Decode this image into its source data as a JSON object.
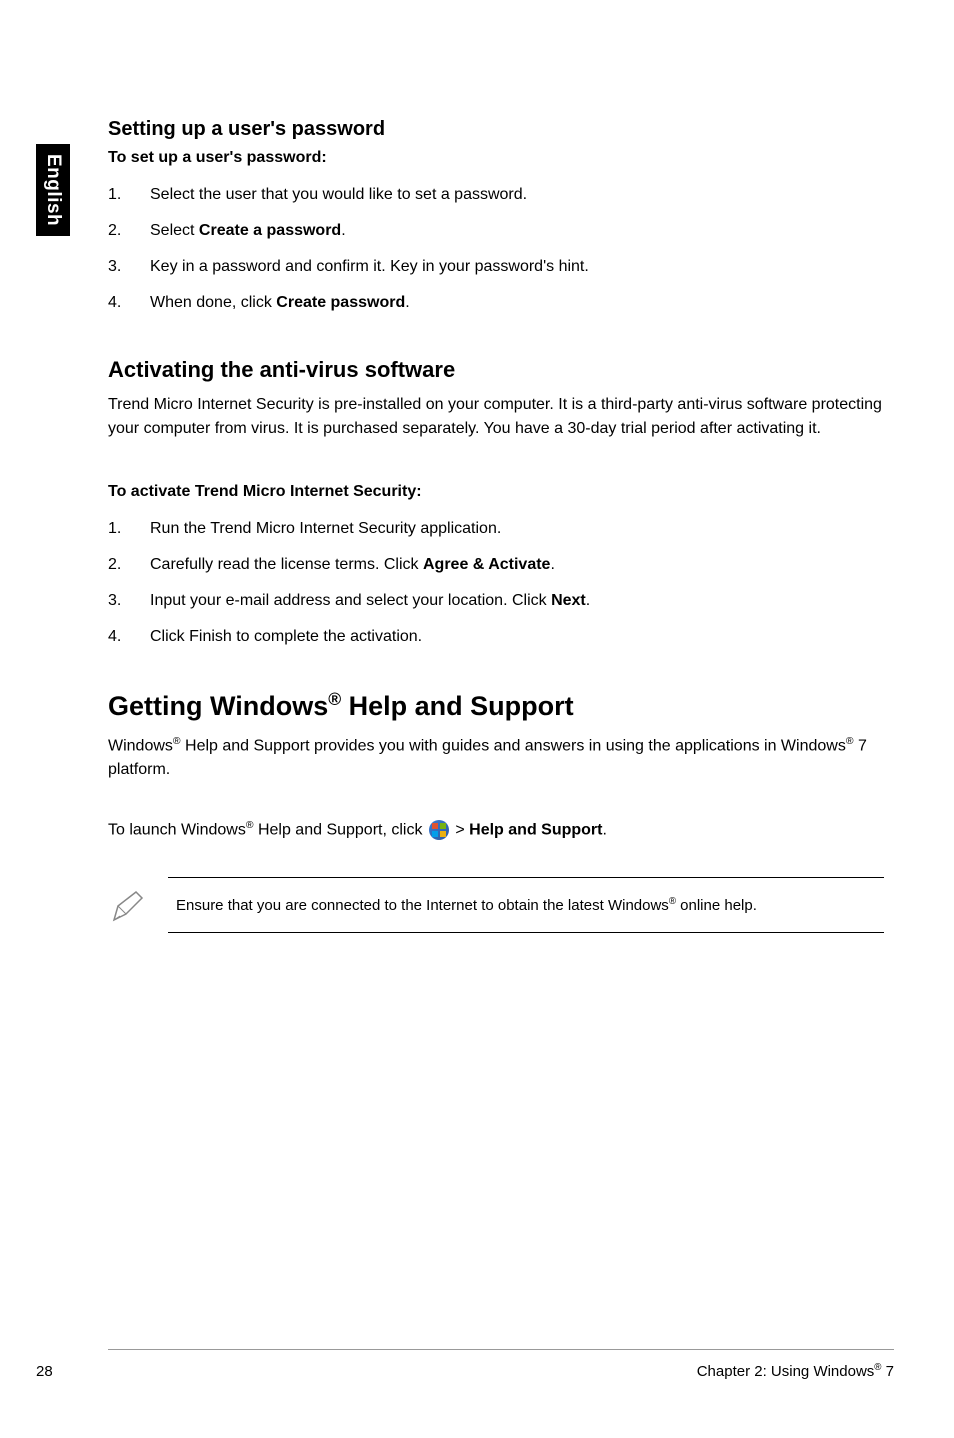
{
  "sideTab": "English",
  "section1": {
    "heading": "Setting up a user's password",
    "sub": "To set up a user's password:",
    "items": [
      {
        "n": "1.",
        "pre": "Select the user that you would like to set a password."
      },
      {
        "n": "2.",
        "pre": "Select ",
        "bold": "Create a password",
        "post": "."
      },
      {
        "n": "3.",
        "pre": "Key in a password and confirm it. Key in your password's hint."
      },
      {
        "n": "4.",
        "pre": "When done, click ",
        "bold": "Create password",
        "post": "."
      }
    ]
  },
  "section2": {
    "heading": "Activating the anti-virus software",
    "intro": "Trend Micro Internet Security is pre-installed on your computer. It is a third-party anti-virus software protecting your computer from virus. It is purchased separately. You have a 30-day trial period after activating it.",
    "sub": "To activate Trend Micro Internet Security:",
    "items": [
      {
        "n": "1.",
        "pre": "Run the Trend Micro Internet Security application."
      },
      {
        "n": "2.",
        "pre": "Carefully read the license terms. Click ",
        "bold": "Agree & Activate",
        "post": "."
      },
      {
        "n": "3.",
        "pre": "Input your e-mail address and select your location. Click ",
        "bold": "Next",
        "post": "."
      },
      {
        "n": "4.",
        "pre": "Click Finish to complete the activation."
      }
    ]
  },
  "section3": {
    "heading_pre": "Getting Windows",
    "heading_sup": "®",
    "heading_post": " Help and Support",
    "intro_pre": "Windows",
    "intro_sup1": "®",
    "intro_mid": " Help and Support provides you with guides and answers in using the applications in Windows",
    "intro_sup2": "®",
    "intro_post": " 7 platform.",
    "launch_pre": "To launch Windows",
    "launch_sup": "®",
    "launch_mid": " Help and Support, click ",
    "launch_gt": " > ",
    "launch_bold": "Help and Support",
    "launch_post": ".",
    "note_pre": "Ensure that you are connected to the Internet to obtain the latest Windows",
    "note_sup": "®",
    "note_post": " online help."
  },
  "footer": {
    "page": "28",
    "chapter_pre": "Chapter 2: Using Windows",
    "chapter_sup": "®",
    "chapter_post": " 7"
  }
}
